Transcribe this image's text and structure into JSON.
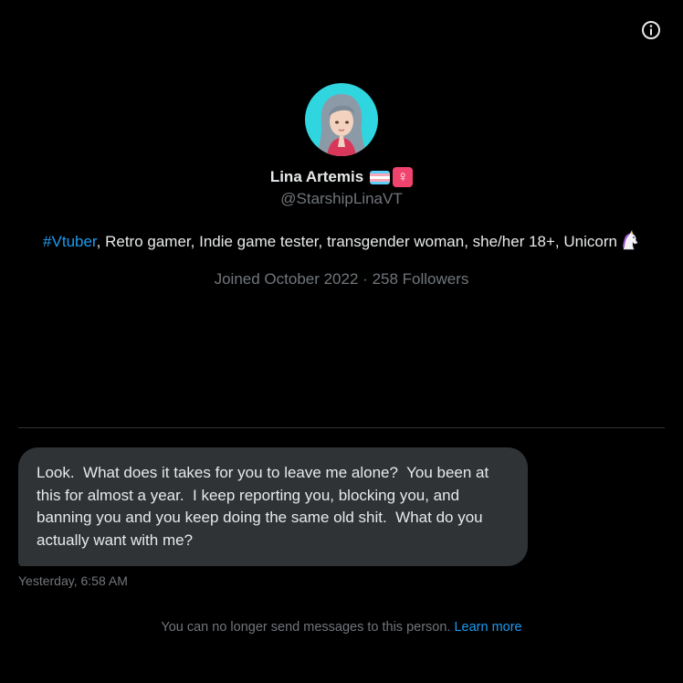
{
  "header": {
    "info_icon": "info-circle-icon"
  },
  "profile": {
    "avatar_icon": "avatar-image",
    "display_name": "Lina Artemis",
    "name_emojis": [
      "transgender-flag-icon",
      "female-sign-icon"
    ],
    "female_glyph": "♀",
    "handle": "@StarshipLinaVT",
    "bio": {
      "hashtag": "#Vtuber",
      "text": ", Retro gamer, Indie game tester, transgender woman, she/her 18+, Unicorn",
      "emoji": "unicorn-icon"
    },
    "joined": "Joined October 2022",
    "separator": "·",
    "followers": "258 Followers"
  },
  "conversation": {
    "messages": [
      {
        "text": "Look.  What does it takes for you to leave me alone?  You been at this for almost a year.  I keep reporting you, blocking you, and banning you and you keep doing the same old shit.  What do you actually want with me?",
        "timestamp": "Yesterday, 6:58 AM"
      }
    ]
  },
  "footer": {
    "notice": "You can no longer send messages to this person.",
    "learn_more": "Learn more"
  },
  "colors": {
    "background": "#000000",
    "text_primary": "#e7e9ea",
    "text_secondary": "#71767b",
    "accent": "#1d9bf0",
    "bubble": "#2f3336",
    "divider": "#2f3336"
  }
}
